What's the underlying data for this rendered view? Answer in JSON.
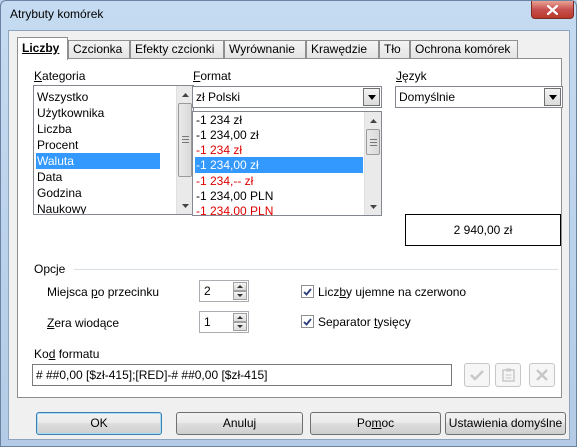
{
  "window": {
    "title": "Atrybuty komórek"
  },
  "tabs": [
    {
      "label": "Liczby",
      "active": true
    },
    {
      "label": "Czcionka",
      "active": false
    },
    {
      "label": "Efekty czcionki",
      "active": false
    },
    {
      "label": "Wyrównanie",
      "active": false
    },
    {
      "label": "Krawędzie",
      "active": false
    },
    {
      "label": "Tło",
      "active": false
    },
    {
      "label": "Ochrona komórek",
      "active": false
    }
  ],
  "category": {
    "label": "Kategoria",
    "items": [
      "Wszystko",
      "Użytkownika",
      "Liczba",
      "Procent",
      "Waluta",
      "Data",
      "Godzina",
      "Naukowy"
    ],
    "selected": "Waluta"
  },
  "format": {
    "label": "Format",
    "combo_value": "zł Polski",
    "items": [
      {
        "text": "-1 234 zł",
        "red": false
      },
      {
        "text": "-1 234,00 zł",
        "red": false
      },
      {
        "text": "-1 234 zł",
        "red": true
      },
      {
        "text": "-1 234,00 zł",
        "red": true,
        "selected": true
      },
      {
        "text": "-1 234,-- zł",
        "red": true
      },
      {
        "text": "-1 234,00 PLN",
        "red": false
      },
      {
        "text": "-1 234,00 PLN",
        "red": true
      }
    ]
  },
  "language": {
    "label": "Język",
    "value": "Domyślnie"
  },
  "preview": {
    "value": "2 940,00 zł"
  },
  "options": {
    "label": "Opcje",
    "decimal_places_label": "Miejsca po przecinku",
    "decimal_places_value": "2",
    "leading_zeros_label": "Zera wiodące",
    "leading_zeros_value": "1",
    "negative_red_label": "Liczby ujemne na czerwono",
    "negative_red_checked": true,
    "thousands_sep_label": "Separator tysięcy",
    "thousands_sep_checked": true
  },
  "format_code": {
    "label": "Kod formatu",
    "value": "# ##0,00 [$zł-415];[RED]-# ##0,00 [$zł-415]"
  },
  "buttons": {
    "ok": "OK",
    "cancel": "Anuluj",
    "help": "Pomoc",
    "reset": "Ustawienia domyślne"
  },
  "colors": {
    "selection": "#3399ff",
    "negative": "#e00000"
  }
}
